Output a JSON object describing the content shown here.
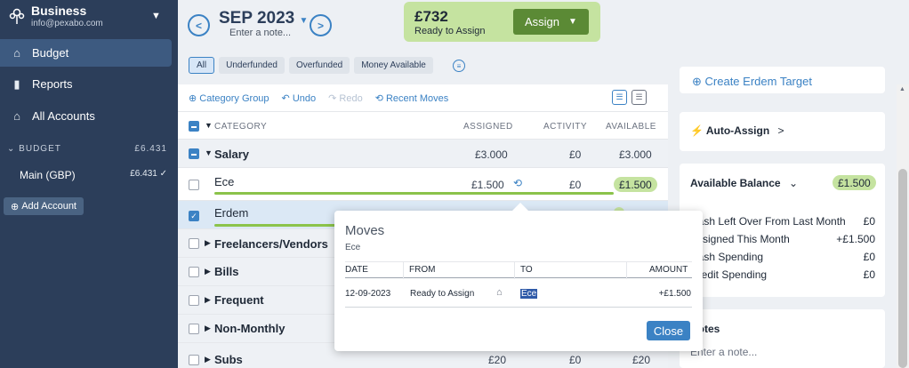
{
  "sidebar": {
    "business_name": "Business",
    "email": "info@pexabo.com",
    "nav": [
      {
        "label": "Budget"
      },
      {
        "label": "Reports"
      },
      {
        "label": "All Accounts"
      }
    ],
    "budget_header": "BUDGET",
    "budget_total": "£6.431",
    "accounts": [
      {
        "name": "Main (GBP)",
        "amount": "£6.431"
      }
    ],
    "add_account": "Add Account"
  },
  "header": {
    "month": "SEP 2023",
    "note_placeholder": "Enter a note...",
    "ready_amount": "£732",
    "ready_label": "Ready to Assign",
    "assign_label": "Assign",
    "filters": [
      "All",
      "Underfunded",
      "Overfunded",
      "Money Available"
    ]
  },
  "toolbar": {
    "category_group": "Category Group",
    "undo": "Undo",
    "redo": "Redo",
    "recent_moves": "Recent Moves"
  },
  "table": {
    "columns": {
      "category": "CATEGORY",
      "assigned": "ASSIGNED",
      "activity": "ACTIVITY",
      "available": "AVAILABLE"
    },
    "salary": {
      "name": "Salary",
      "assigned": "£3.000",
      "activity": "£0",
      "available": "£3.000"
    },
    "ece": {
      "name": "Ece",
      "assigned": "£1.500",
      "activity": "£0",
      "available": "£1.500",
      "progress": 1.0
    },
    "erdem": {
      "name": "Erdem",
      "progress": 1.0
    },
    "groups": [
      "Freelancers/Vendors",
      "Bills",
      "Frequent",
      "Non-Monthly",
      "Subs"
    ],
    "subs": {
      "assigned": "£20",
      "activity": "£0",
      "available": "£20"
    }
  },
  "right_panel": {
    "create_target": "Create Erdem Target",
    "auto_assign": "Auto-Assign",
    "balance_title": "Available Balance",
    "balance_amount": "£1.500",
    "lines": [
      {
        "label": "Cash Left Over From Last Month",
        "value": "£0"
      },
      {
        "label": "Assigned This Month",
        "value": "+£1.500"
      },
      {
        "label": "Cash Spending",
        "value": "£0"
      },
      {
        "label": "Credit Spending",
        "value": "£0"
      }
    ],
    "notes_title": "Notes",
    "notes_placeholder": "Enter a note..."
  },
  "popup": {
    "title": "Moves",
    "subtitle": "Ece",
    "headers": {
      "date": "DATE",
      "from": "FROM",
      "to": "TO",
      "amount": "AMOUNT"
    },
    "row": {
      "date": "12-09-2023",
      "from": "Ready to Assign",
      "to": "Ece",
      "amount": "+£1.500"
    },
    "close": "Close"
  },
  "colors": {
    "sidebar": "#2c3e5a",
    "accent": "#3b82c4",
    "green": "#5b8a35",
    "money_pill": "#c5e3a0"
  }
}
